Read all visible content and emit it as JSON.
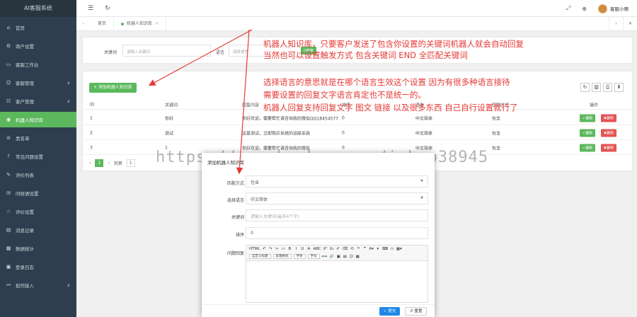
{
  "sidebar": {
    "brand": "AI客服系统",
    "items": [
      {
        "label": "首页",
        "icon": "home-icon",
        "glyph": "⌂",
        "chevron": false,
        "active": false
      },
      {
        "label": "商户设置",
        "icon": "gear-icon",
        "glyph": "⚙",
        "chevron": false,
        "active": false
      },
      {
        "label": "客服工作台",
        "icon": "desk-icon",
        "glyph": "▭",
        "chevron": false,
        "active": false
      },
      {
        "label": "客服管理",
        "icon": "user-icon",
        "glyph": "☺",
        "chevron": true,
        "active": false
      },
      {
        "label": "客户管理",
        "icon": "users-icon",
        "glyph": "☷",
        "chevron": true,
        "active": false
      },
      {
        "label": "机器人知识库",
        "icon": "robot-icon",
        "glyph": "◉",
        "chevron": false,
        "active": true
      },
      {
        "label": "黑名单",
        "icon": "ban-icon",
        "glyph": "⊘",
        "chevron": false,
        "active": false
      },
      {
        "label": "常见问题设置",
        "icon": "question-icon",
        "glyph": "?",
        "chevron": false,
        "active": false
      },
      {
        "label": "评价列表",
        "icon": "comment-icon",
        "glyph": "✎",
        "chevron": false,
        "active": false
      },
      {
        "label": "问候语设置",
        "icon": "chat-icon",
        "glyph": "✉",
        "chevron": false,
        "active": false
      },
      {
        "label": "评价设置",
        "icon": "star-icon",
        "glyph": "☆",
        "chevron": false,
        "active": false
      },
      {
        "label": "消息记录",
        "icon": "message-icon",
        "glyph": "▤",
        "chevron": false,
        "active": false
      },
      {
        "label": "数据统计",
        "icon": "chart-icon",
        "glyph": "▦",
        "chevron": false,
        "active": false
      },
      {
        "label": "登录日志",
        "icon": "log-icon",
        "glyph": "▣",
        "chevron": false,
        "active": false
      },
      {
        "label": "如何接入",
        "icon": "link-icon",
        "glyph": "⚯",
        "chevron": true,
        "active": false
      }
    ]
  },
  "topbar": {
    "menu_icon": "☰",
    "refresh_icon": "↻",
    "bell_icon": "⤢",
    "globe_icon": "⊕",
    "user_name": "客服小晴"
  },
  "tabs": {
    "prev": "‹",
    "next": "›",
    "items": [
      {
        "label": "首页",
        "closable": false
      },
      {
        "label": "机器人知识库",
        "closable": true,
        "close": "×"
      }
    ],
    "ctrl_right": "›",
    "ctrl_close": "✕"
  },
  "search": {
    "keyword_label": "关键词",
    "keyword_placeholder": "请输入关键词",
    "language_label": "语言",
    "language_placeholder": "选择语言",
    "search_button": "Q搜索"
  },
  "toolbar": {
    "add_button": "+ 添加机器人知识库",
    "tool_icons": [
      "↻",
      "▥",
      "⎙",
      "⬇"
    ]
  },
  "table": {
    "headers": {
      "id": "ID",
      "keyword": "关键词",
      "reply": "回复内容",
      "sort": "排序",
      "language": "语言",
      "mode": "匹配方式",
      "action": "操作"
    },
    "rows": [
      {
        "id": "1",
        "keyword": "你好",
        "reply": "你好欢迎，需要帮忙请咨询我的微信QQ18454577",
        "sort": "0",
        "language": "中文简体",
        "mode": "包含",
        "edit": "✓编辑",
        "delete": "✖删除"
      },
      {
        "id": "2",
        "keyword": "测试",
        "reply": "这是测试，立即购买系统的话联系我",
        "sort": "0",
        "language": "中文简体",
        "mode": "包含",
        "edit": "✓编辑",
        "delete": "✖删除"
      },
      {
        "id": "3",
        "keyword": "1",
        "reply": "你好欢迎，需要帮忙请咨询我的微信",
        "sort": "0",
        "language": "中文简体",
        "mode": "包含",
        "edit": "✓编辑",
        "delete": "✖删除"
      }
    ]
  },
  "pager": {
    "prev": "‹",
    "current": "1",
    "next": "›",
    "goto_label": "到第",
    "page_input": "1"
  },
  "annotations": {
    "a1_line1": "机器人知识库，只要客户发送了包含你设置的关键词机器人就会自动回复",
    "a1_line2": "当然也可以设置触发方式 包含关键词 END 全匹配关键词",
    "a2_line1": "选择语言的意思就是在哪个语言生效这个设置 因为有很多种语言接待",
    "a2_line2": "需要设置的回复文字语言肯定也不是统一的。",
    "a2_line3": "机器人回复支持回复文字 图文 链接 以及很多东西 自己自行设置就行了"
  },
  "watermark": "https://www.huzhan.com/ishop38945",
  "modal": {
    "title": "添加机器人知识库",
    "mode_label": "匹配方式",
    "mode_value": "包含",
    "language_label": "选择语言",
    "language_value": "中文简体",
    "keyword_label": "关键词",
    "keyword_placeholder": "请输入关键词(最多6个字)",
    "sort_label": "排序",
    "sort_value": "0",
    "reply_label": "问题回复",
    "editor_row1": [
      "HTML",
      "↶",
      "↷",
      "✂",
      "▭",
      "B",
      "I",
      "U",
      "A̶",
      "ABC",
      "X²",
      "X₂",
      "✐",
      "⌫",
      "⟲",
      "❝",
      "❞",
      "A▾",
      "▾",
      "⌨",
      "▭",
      "▦▾"
    ],
    "editor_row2_selects": [
      "自定义标题",
      "段落格式",
      "字体",
      "字号"
    ],
    "editor_row2_tools": [
      "⟺",
      "🔗",
      "▣",
      "▤",
      "☺",
      "▦"
    ],
    "submit": "✓ 提交",
    "reset": "↺ 重置"
  }
}
